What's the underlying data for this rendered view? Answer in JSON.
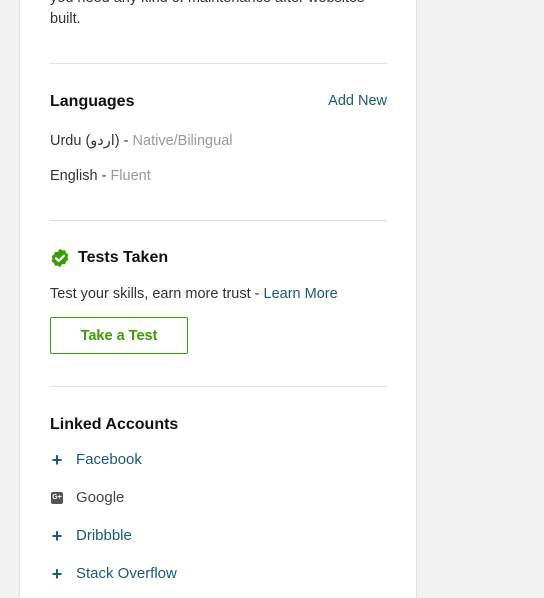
{
  "intro": {
    "text": "you need any kind of maintenance after websites built."
  },
  "languages": {
    "title": "Languages",
    "add_label": "Add New",
    "items": [
      {
        "name": "Urdu (اردو)",
        "separator": " - ",
        "level": "Native/Bilingual"
      },
      {
        "name": "English",
        "separator": " - ",
        "level": "Fluent"
      }
    ]
  },
  "tests": {
    "title": "Tests Taken",
    "desc": "Test your skills, earn more trust - ",
    "learn_more": "Learn More",
    "button": "Take a Test",
    "icon": "check-badge-icon"
  },
  "linked_accounts": {
    "title": "Linked Accounts",
    "items": [
      {
        "label": "Facebook",
        "icon": "plus-icon"
      },
      {
        "label": "Google",
        "icon": "google-plus-icon"
      },
      {
        "label": "Dribbble",
        "icon": "plus-icon"
      },
      {
        "label": "Stack Overflow",
        "icon": "plus-icon"
      }
    ]
  },
  "colors": {
    "accent_green": "#37a000",
    "link_blue": "#1c5a7a",
    "muted": "#9a9a9a"
  }
}
